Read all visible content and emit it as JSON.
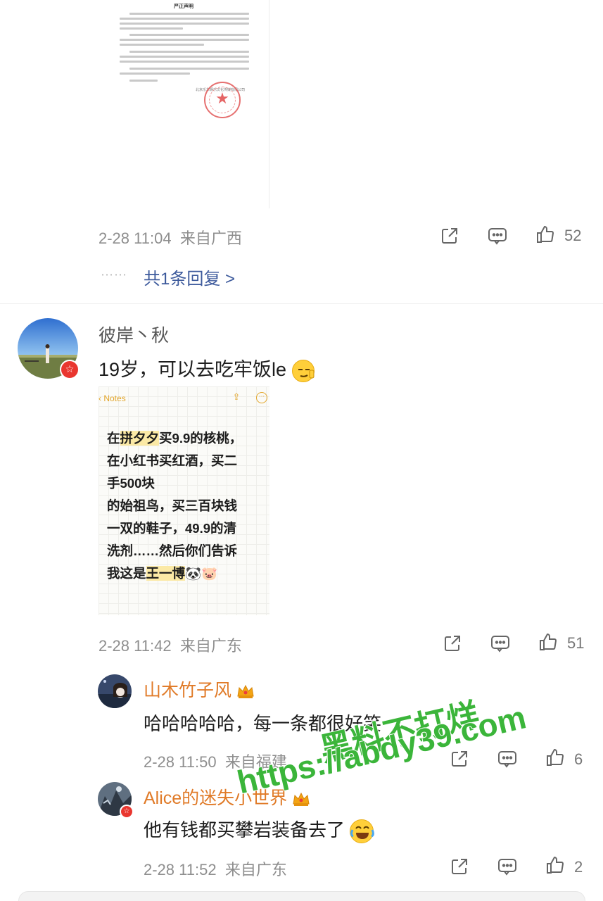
{
  "statement": {
    "title": "严正声明",
    "company": "北京乐华娱乐文化传媒有限公司"
  },
  "comment_1_meta": {
    "time": "2-28 11:04",
    "location": "来自广西",
    "likes": "52"
  },
  "replies_link": {
    "dots": "⋯⋯",
    "label": "共1条回复 >"
  },
  "comment_2": {
    "user_name": "彼岸丶秋",
    "text": "19岁，可以去吃牢饭le",
    "time": "2-28 11:42",
    "location": "来自广东",
    "likes": "51",
    "notes_image": {
      "back_label": "Notes",
      "lines": [
        {
          "pre": "在",
          "hl": "拼夕夕",
          "post": "买9.9的核桃，"
        },
        {
          "pre": "在小红书买红酒，买二",
          "hl": "",
          "post": ""
        },
        {
          "pre": "手500块",
          "hl": "",
          "post": ""
        },
        {
          "pre": "的始祖鸟，买三百块钱",
          "hl": "",
          "post": ""
        },
        {
          "pre": "一双的鞋子，49.9的清",
          "hl": "",
          "post": ""
        },
        {
          "pre": "洗剂……然后你们告诉",
          "hl": "",
          "post": ""
        },
        {
          "pre": "我这是",
          "hl": "王一博",
          "post": "🐼🐷"
        }
      ]
    }
  },
  "reply_1": {
    "user_name": "山木竹子风",
    "text": "哈哈哈哈哈，每一条都很好笑",
    "time": "2-28 11:50",
    "location": "来自福建",
    "likes": "6"
  },
  "reply_2": {
    "user_name": "Alice的迷失小世界",
    "text": "他有钱都买攀岩装备去了",
    "time": "2-28 11:52",
    "location": "来自广东",
    "likes": "2"
  },
  "watermark": {
    "line1": "黑料不打烊",
    "line2": "https://abdy39.com"
  },
  "colors": {
    "link_blue": "#3d5a9c",
    "vip_orange": "#e07a27",
    "watermark_green": "#3bb53a",
    "badge_red": "#e9362f"
  }
}
